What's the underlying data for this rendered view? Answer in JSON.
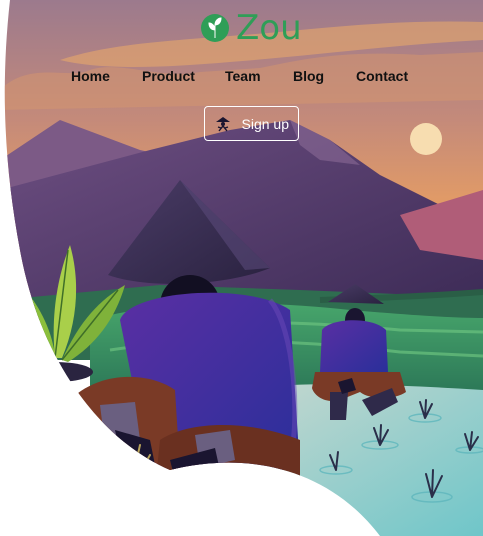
{
  "brand": {
    "name": "Zou",
    "logo_icon": "leaf-icon",
    "accent_color": "#2f9e57"
  },
  "nav": {
    "items": [
      {
        "label": "Home"
      },
      {
        "label": "Product"
      },
      {
        "label": "Team"
      },
      {
        "label": "Blog"
      },
      {
        "label": "Contact"
      }
    ]
  },
  "cta": {
    "label": "Sign up",
    "icon": "rice-farmer-icon"
  },
  "hero": {
    "illustration": "rice-farmers-planting-in-paddy-field-at-sunset",
    "colors": {
      "sky_top": "#8e6f88",
      "sky_bottom": "#f0a45a",
      "mountain": "#5b3e70",
      "field": "#3d8f63",
      "water": "#8fd3d8",
      "shirt": "#3a2e9e"
    }
  }
}
